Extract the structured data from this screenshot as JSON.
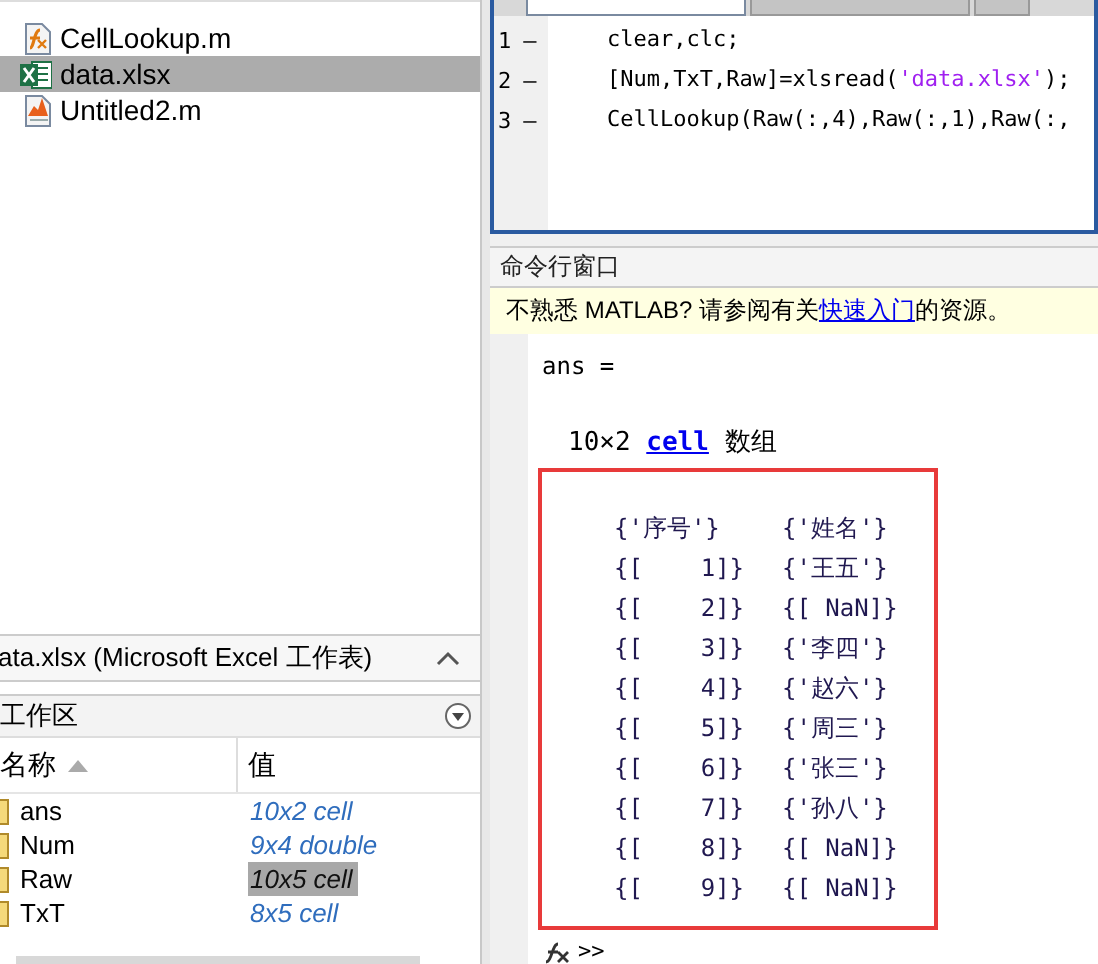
{
  "files": [
    {
      "name": "CellLookup.m",
      "kind": "function",
      "selected": false
    },
    {
      "name": "data.xlsx",
      "kind": "excel",
      "selected": true
    },
    {
      "name": "Untitled2.m",
      "kind": "script",
      "selected": false
    }
  ],
  "details": {
    "title": "ata.xlsx (Microsoft Excel 工作表)"
  },
  "workspace": {
    "title": "工作区",
    "columns": [
      {
        "label": "名称",
        "sorted": true
      },
      {
        "label": "值",
        "sorted": false
      }
    ],
    "variables": [
      {
        "name": "ans",
        "value": "10x2 cell",
        "selected": false
      },
      {
        "name": "Num",
        "value": "9x4 double",
        "selected": false
      },
      {
        "name": "Raw",
        "value": "10x5 cell",
        "selected": true
      },
      {
        "name": "TxT",
        "value": "8x5 cell",
        "selected": false
      }
    ]
  },
  "editor": {
    "tabs": [
      {
        "selected": true
      },
      {
        "selected": false
      },
      {
        "selected": false
      }
    ],
    "lines": [
      {
        "number": "1",
        "marker": "–",
        "parts": [
          {
            "kind": "code",
            "text": "    clear,clc;"
          }
        ]
      },
      {
        "number": "2",
        "marker": "–",
        "parts": [
          {
            "kind": "code",
            "text": "    [Num,TxT,Raw]=xlsread("
          },
          {
            "kind": "string",
            "text": "'data.xlsx'"
          },
          {
            "kind": "code",
            "text": ");"
          }
        ]
      },
      {
        "number": "3",
        "marker": "–",
        "parts": [
          {
            "kind": "code",
            "text": "    CellLookup(Raw(:,4),Raw(:,1),Raw(:,"
          }
        ]
      }
    ]
  },
  "command_window": {
    "title": "命令行窗口",
    "notice": {
      "before": "不熟悉 MATLAB? 请参阅有关",
      "link": "快速入门",
      "after": "的资源。"
    },
    "output": "ans =",
    "size_line": {
      "dims": "10×2",
      "link": "cell",
      "suffix": "数组"
    },
    "cell_rows": [
      [
        "{'序号'}",
        "{'姓名'}"
      ],
      [
        "{[    1]}",
        "{'王五'}"
      ],
      [
        "{[    2]}",
        "{[ NaN]}"
      ],
      [
        "{[    3]}",
        "{'李四'}"
      ],
      [
        "{[    4]}",
        "{'赵六'}"
      ],
      [
        "{[    5]}",
        "{'周三'}"
      ],
      [
        "{[    6]}",
        "{'张三'}"
      ],
      [
        "{[    7]}",
        "{'孙八'}"
      ],
      [
        "{[    8]}",
        "{[ NaN]}"
      ],
      [
        "{[    9]}",
        "{[ NaN]}"
      ]
    ],
    "prompt": ">>"
  }
}
